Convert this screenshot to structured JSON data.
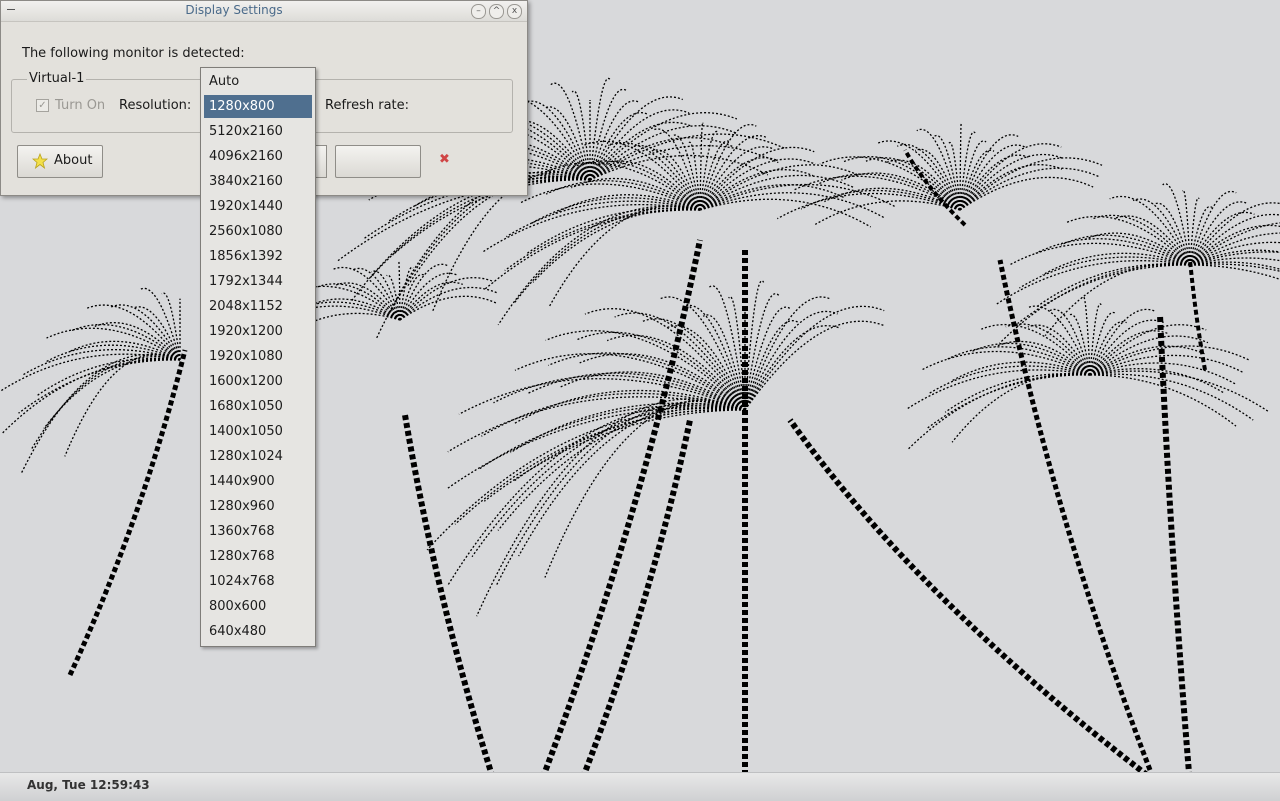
{
  "window": {
    "title": "Display Settings",
    "detected_label": "The following monitor is detected:",
    "monitor_name": "Virtual-1",
    "turn_on_label": "Turn On",
    "turn_on_checked": true,
    "resolution_label": "Resolution:",
    "refresh_label": "Refresh rate:",
    "about_label": "About"
  },
  "dropdown": {
    "selected_index": 1,
    "options": [
      "Auto",
      "1280x800",
      "5120x2160",
      "4096x2160",
      "3840x2160",
      "1920x1440",
      "2560x1080",
      "1856x1392",
      "1792x1344",
      "2048x1152",
      "1920x1200",
      "1920x1080",
      "1600x1200",
      "1680x1050",
      "1400x1050",
      "1280x1024",
      "1440x900",
      "1280x960",
      "1360x768",
      "1280x768",
      "1024x768",
      "800x600",
      "640x480"
    ]
  },
  "taskbar": {
    "clock": "Aug, Tue 12:59:43"
  },
  "colors": {
    "selection": "#4f6f8f",
    "wallpaper_bg": "#d8d9db",
    "wallpaper_ink": "#000000",
    "title_text": "#4a6a8a",
    "close_icon": "#d04545"
  }
}
